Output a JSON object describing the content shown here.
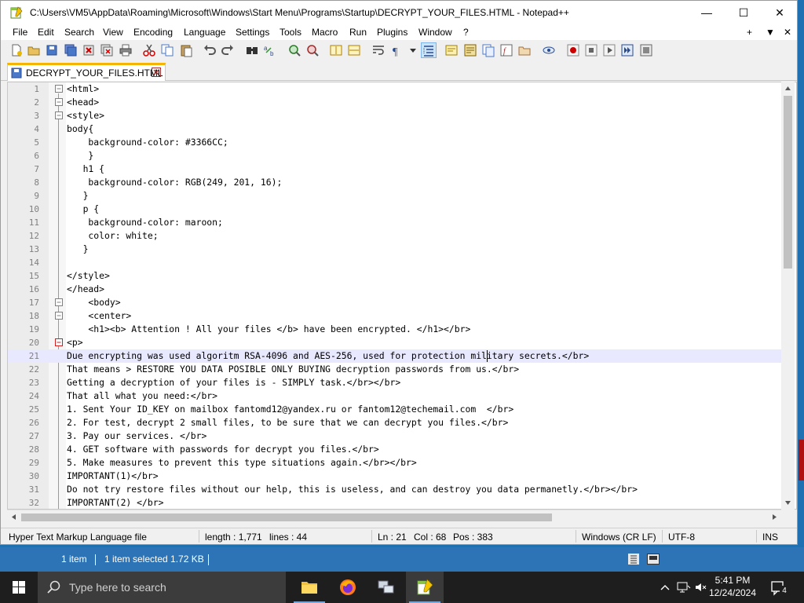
{
  "window": {
    "title": "C:\\Users\\VM5\\AppData\\Roaming\\Microsoft\\Windows\\Start Menu\\Programs\\Startup\\DECRYPT_YOUR_FILES.HTML - Notepad++",
    "minimize_label": "—",
    "maximize_label": "☐",
    "close_label": "✕"
  },
  "menu": {
    "items": [
      "File",
      "Edit",
      "Search",
      "View",
      "Encoding",
      "Language",
      "Settings",
      "Tools",
      "Macro",
      "Run",
      "Plugins",
      "Window",
      "?"
    ],
    "right_items": [
      "+",
      "▼",
      "✕"
    ]
  },
  "tab": {
    "label": "DECRYPT_YOUR_FILES.HTML"
  },
  "editor": {
    "current_line": 21,
    "lines": [
      {
        "n": "1",
        "text": "<html>"
      },
      {
        "n": "2",
        "text": "<head>"
      },
      {
        "n": "3",
        "text": "<style>"
      },
      {
        "n": "4",
        "text": "body{"
      },
      {
        "n": "5",
        "text": "    background-color: #3366CC;"
      },
      {
        "n": "6",
        "text": "    }"
      },
      {
        "n": "7",
        "text": "   h1 {"
      },
      {
        "n": "8",
        "text": "    background-color: RGB(249, 201, 16);"
      },
      {
        "n": "9",
        "text": "   }"
      },
      {
        "n": "10",
        "text": "   p {"
      },
      {
        "n": "11",
        "text": "    background-color: maroon;"
      },
      {
        "n": "12",
        "text": "    color: white;"
      },
      {
        "n": "13",
        "text": "   }"
      },
      {
        "n": "14",
        "text": ""
      },
      {
        "n": "15",
        "text": "</style>"
      },
      {
        "n": "16",
        "text": "</head>"
      },
      {
        "n": "17",
        "text": "    <body>"
      },
      {
        "n": "18",
        "text": "    <center>"
      },
      {
        "n": "19",
        "text": "    <h1><b> Attention ! All your files </b> have been encrypted. </h1></br>"
      },
      {
        "n": "20",
        "text": "<p>"
      },
      {
        "n": "21",
        "text": "Due encrypting was used algoritm RSA-4096 and AES-256, used for protection military secrets.</br>"
      },
      {
        "n": "22",
        "text": "That means > RESTORE YOU DATA POSIBLE ONLY BUYING decryption passwords from us.</br>"
      },
      {
        "n": "23",
        "text": "Getting a decryption of your files is - SIMPLY task.</br></br>"
      },
      {
        "n": "24",
        "text": "That all what you need:</br>"
      },
      {
        "n": "25",
        "text": "1. Sent Your ID_KEY on mailbox fantomd12@yandex.ru or fantom12@techemail.com  </br>"
      },
      {
        "n": "26",
        "text": "2. For test, decrypt 2 small files, to be sure that we can decrypt you files.</br>"
      },
      {
        "n": "27",
        "text": "3. Pay our services. </br>"
      },
      {
        "n": "28",
        "text": "4. GET software with passwords for decrypt you files.</br>"
      },
      {
        "n": "29",
        "text": "5. Make measures to prevent this type situations again.</br></br>"
      },
      {
        "n": "30",
        "text": "IMPORTANT(1)</br>"
      },
      {
        "n": "31",
        "text": "Do not try restore files without our help, this is useless, and can destroy you data permanetly.</br></br>"
      },
      {
        "n": "32",
        "text": "IMPORTANT(2) </br>"
      }
    ]
  },
  "status": {
    "file_type": "Hyper Text Markup Language file",
    "length": "length : 1,771",
    "lines": "lines : 44",
    "ln": "Ln : 21",
    "col": "Col : 68",
    "pos": "Pos : 383",
    "eol": "Windows (CR LF)",
    "encoding": "UTF-8",
    "mode": "INS"
  },
  "explorer": {
    "count": "1 item",
    "selected": "1 item selected  1.72 KB"
  },
  "taskbar": {
    "search_placeholder": "Type here to search",
    "time": "5:41 PM",
    "date": "12/24/2024",
    "notification_count": "4"
  }
}
